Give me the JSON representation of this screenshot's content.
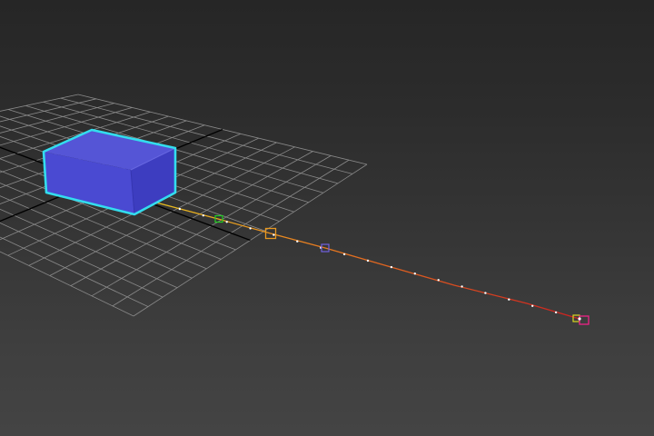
{
  "viewport": {
    "background_top": "#262626",
    "background_bottom": "#444444"
  },
  "grid": {
    "line_color": "#8a8a8a",
    "axis_color": "#000000"
  },
  "box": {
    "top_color": "#5555d6",
    "front_color": "#4a4ad2",
    "side_color": "#3d3dc0",
    "selection_color": "#33ddee"
  },
  "trajectory": {
    "color_start": "#e8c020",
    "color_mid": "#e88020",
    "color_end": "#cc2020",
    "tick_color": "#ffffff",
    "keys": [
      {
        "name": "key-green",
        "color": "#22cc22"
      },
      {
        "name": "key-orange",
        "color": "#e89820"
      },
      {
        "name": "key-blue",
        "color": "#7060e0"
      },
      {
        "name": "key-end-yellow",
        "color": "#d8d820"
      },
      {
        "name": "key-end-magenta",
        "color": "#ee2288"
      }
    ]
  }
}
